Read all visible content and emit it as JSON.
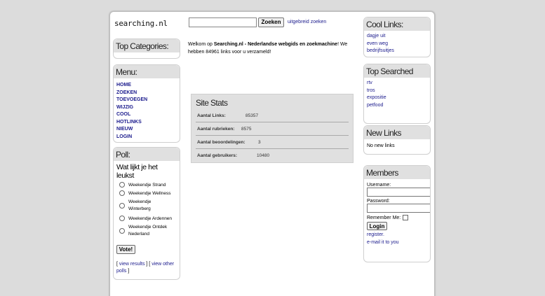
{
  "header": {
    "logo": "searching.nl",
    "search_value": "",
    "search_button": "Zoeken",
    "advanced_link": "uitgebreid zoeken"
  },
  "welcome": {
    "prefix": "Welkom op ",
    "site": "Searching.nl - Nederlandse webgids en zoekmachine",
    "suffix": "! We hebben 84961 links voor u verzameld!"
  },
  "top_categories": {
    "title": "Top Categories:"
  },
  "menu": {
    "title": "Menu:",
    "items": [
      "HOME",
      "ZOEKEN",
      "TOEVOEGEN",
      "WIJZIG",
      "COOL",
      "HOTLINKS",
      "NIEUW",
      "LOGIN"
    ]
  },
  "poll": {
    "title": "Poll:",
    "question": "Wat lijkt je het leukst",
    "options": [
      "Weekendje Strand",
      "Weekendje Wellness",
      "Weekendje Winterberg",
      "Weekendje Ardennen",
      "Weekendje Ontdek Nederland"
    ],
    "vote_button": "Vote!",
    "view_results": "view results",
    "view_other": "view other polls"
  },
  "site_stats": {
    "title": "Site Stats",
    "rows": [
      {
        "label": "Aantal Links:",
        "value": "85357"
      },
      {
        "label": "Aantal rubrieken:",
        "value": "8575"
      },
      {
        "label": "Aantal beoordelingen:",
        "value": "3"
      },
      {
        "label": "Aantal gebruikers:",
        "value": "10480"
      }
    ]
  },
  "cool_links": {
    "title": "Cool Links:",
    "items": [
      "dagje uit",
      "even weg",
      "bedrijfsuitjes"
    ]
  },
  "top_searched": {
    "title": "Top Searched",
    "items": [
      "rtv",
      "tros",
      "expositie",
      "petfood"
    ]
  },
  "new_links": {
    "title": "New Links",
    "text": "No new links"
  },
  "members": {
    "title": "Members",
    "username_label": "Username:",
    "password_label": "Password:",
    "remember_label": "Remember Me:",
    "login_button": "Login",
    "register_link": "register.",
    "email_link": "e-mail it to you"
  }
}
